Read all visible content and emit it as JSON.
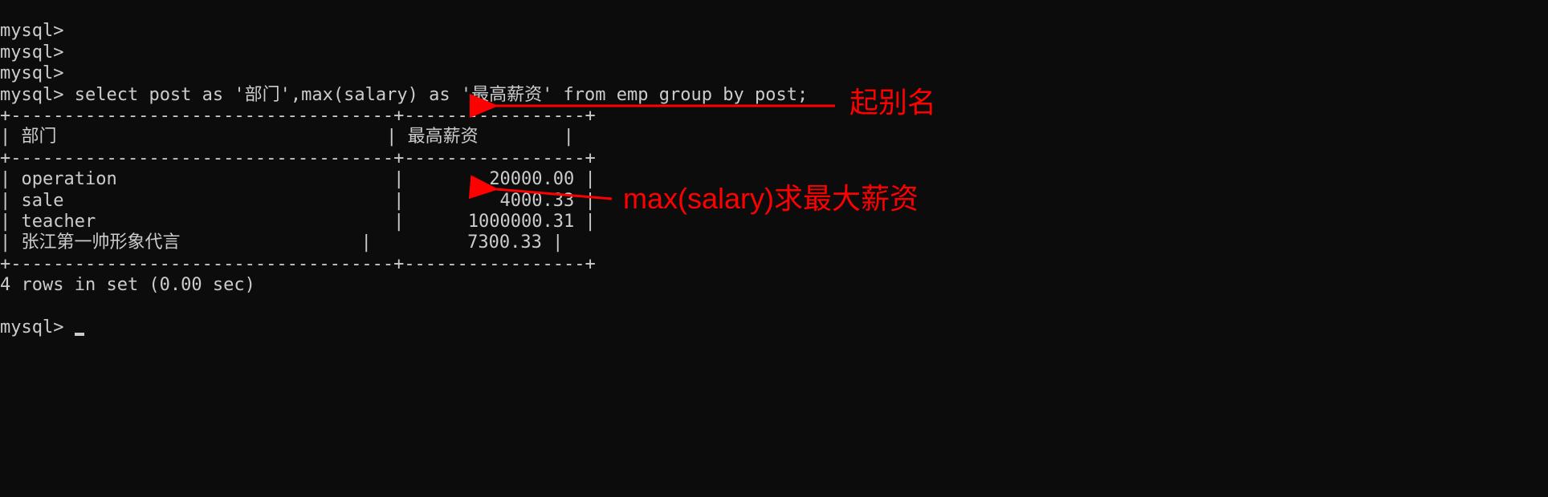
{
  "prompts": {
    "empty1": "mysql>",
    "empty2": "mysql>",
    "empty3": "mysql>",
    "query_prompt": "mysql>",
    "final_prompt": "mysql>"
  },
  "query": " select post as '部门',max(salary) as '最高薪资' from emp group by post;",
  "table": {
    "top_border": "+------------------------------------+-----------------+",
    "header_col1": "部门",
    "header_col2": "最高薪资",
    "mid_border": "+------------------------------------+-----------------+",
    "rows": [
      {
        "post": "operation",
        "salary": "20000.00"
      },
      {
        "post": "sale",
        "salary": "4000.33"
      },
      {
        "post": "teacher",
        "salary": "1000000.31"
      },
      {
        "post": "张江第一帅形象代言",
        "salary": "7300.33"
      }
    ],
    "bottom_border": "+------------------------------------+-----------------+"
  },
  "result_msg": "4 rows in set (0.00 sec)",
  "annotations": {
    "alias_label": "起别名",
    "max_label": "max(salary)求最大薪资"
  },
  "chart_data": {
    "type": "table",
    "title": "select post as '部门',max(salary) as '最高薪资' from emp group by post;",
    "columns": [
      "部门",
      "最高薪资"
    ],
    "rows": [
      [
        "operation",
        20000.0
      ],
      [
        "sale",
        4000.33
      ],
      [
        "teacher",
        1000000.31
      ],
      [
        "张江第一帅形象代言",
        7300.33
      ]
    ]
  }
}
